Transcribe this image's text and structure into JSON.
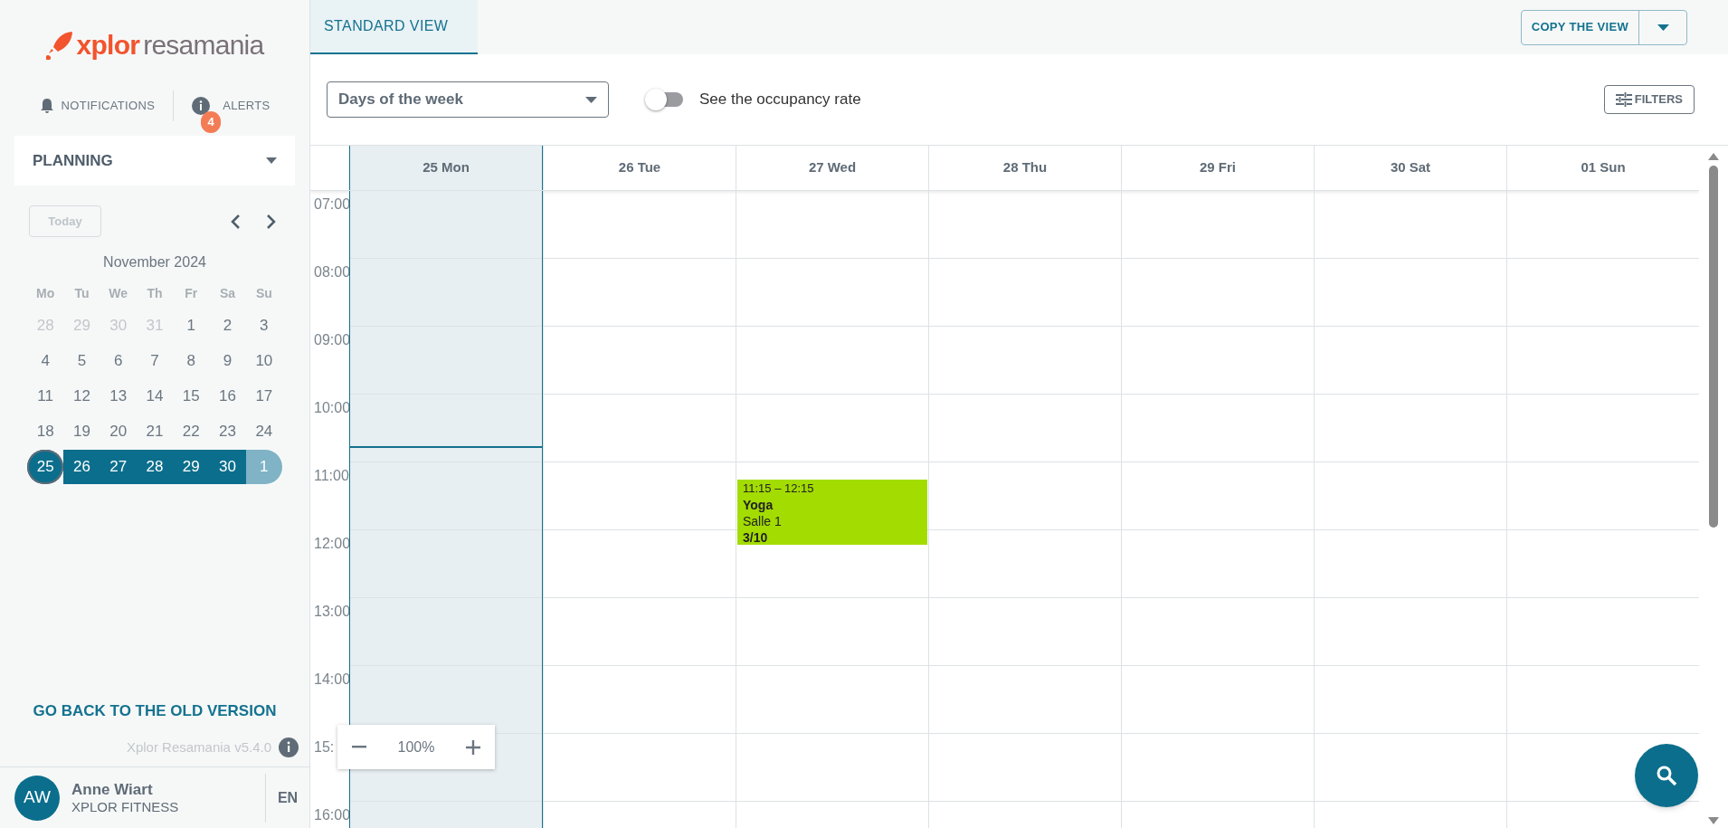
{
  "sidebar": {
    "logo": {
      "brand": "xplor",
      "product": "resamania"
    },
    "notifications": "NOTIFICATIONS",
    "alerts": {
      "label": "ALERTS",
      "count": "4"
    },
    "menu": "PLANNING",
    "today_button": "Today",
    "calendar": {
      "month": "November 2024",
      "weekdays": [
        "Mo",
        "Tu",
        "We",
        "Th",
        "Fr",
        "Sa",
        "Su"
      ],
      "weeks": [
        [
          {
            "day": "28",
            "muted": true,
            "selected": false,
            "today": false
          },
          {
            "day": "29",
            "muted": true,
            "selected": false,
            "today": false
          },
          {
            "day": "30",
            "muted": true,
            "selected": false,
            "today": false
          },
          {
            "day": "31",
            "muted": true,
            "selected": false,
            "today": false
          },
          {
            "day": "1",
            "muted": false,
            "selected": false,
            "today": false
          },
          {
            "day": "2",
            "muted": false,
            "selected": false,
            "today": false
          },
          {
            "day": "3",
            "muted": false,
            "selected": false,
            "today": false
          }
        ],
        [
          {
            "day": "4",
            "muted": false,
            "selected": false,
            "today": false
          },
          {
            "day": "5",
            "muted": false,
            "selected": false,
            "today": false
          },
          {
            "day": "6",
            "muted": false,
            "selected": false,
            "today": false
          },
          {
            "day": "7",
            "muted": false,
            "selected": false,
            "today": false
          },
          {
            "day": "8",
            "muted": false,
            "selected": false,
            "today": false
          },
          {
            "day": "9",
            "muted": false,
            "selected": false,
            "today": false
          },
          {
            "day": "10",
            "muted": false,
            "selected": false,
            "today": false
          }
        ],
        [
          {
            "day": "11",
            "muted": false,
            "selected": false,
            "today": false
          },
          {
            "day": "12",
            "muted": false,
            "selected": false,
            "today": false
          },
          {
            "day": "13",
            "muted": false,
            "selected": false,
            "today": false
          },
          {
            "day": "14",
            "muted": false,
            "selected": false,
            "today": false
          },
          {
            "day": "15",
            "muted": false,
            "selected": false,
            "today": false
          },
          {
            "day": "16",
            "muted": false,
            "selected": false,
            "today": false
          },
          {
            "day": "17",
            "muted": false,
            "selected": false,
            "today": false
          }
        ],
        [
          {
            "day": "18",
            "muted": false,
            "selected": false,
            "today": false
          },
          {
            "day": "19",
            "muted": false,
            "selected": false,
            "today": false
          },
          {
            "day": "20",
            "muted": false,
            "selected": false,
            "today": false
          },
          {
            "day": "21",
            "muted": false,
            "selected": false,
            "today": false
          },
          {
            "day": "22",
            "muted": false,
            "selected": false,
            "today": false
          },
          {
            "day": "23",
            "muted": false,
            "selected": false,
            "today": false
          },
          {
            "day": "24",
            "muted": false,
            "selected": false,
            "today": false
          }
        ],
        [
          {
            "day": "25",
            "muted": false,
            "selected": true,
            "today": true
          },
          {
            "day": "26",
            "muted": false,
            "selected": true,
            "today": false
          },
          {
            "day": "27",
            "muted": false,
            "selected": true,
            "today": false
          },
          {
            "day": "28",
            "muted": false,
            "selected": true,
            "today": false
          },
          {
            "day": "29",
            "muted": false,
            "selected": true,
            "today": false
          },
          {
            "day": "30",
            "muted": false,
            "selected": true,
            "today": false
          },
          {
            "day": "1",
            "muted": true,
            "selected": true,
            "today": false
          }
        ]
      ]
    },
    "back_link": "GO BACK TO THE OLD VERSION",
    "version": "Xplor Resamania v5.4.0",
    "user": {
      "initials": "AW",
      "name": "Anne Wiart",
      "company": "XPLOR FITNESS"
    },
    "language": "EN"
  },
  "tabs": [
    {
      "label": "STANDARD VIEW",
      "selected": true
    }
  ],
  "copy_button": "COPY THE VIEW",
  "view_select": {
    "value": "Days of the week"
  },
  "occupancy_toggle": {
    "label": "See the occupancy rate",
    "on": false
  },
  "filters_button": "FILTERS",
  "days": [
    {
      "label": "25 Mon",
      "today": true
    },
    {
      "label": "26 Tue",
      "today": false
    },
    {
      "label": "27 Wed",
      "today": false,
      "events": [
        {
          "time": "11:15 – 12:15",
          "title": "Yoga",
          "room": "Salle 1",
          "occupancy": "3/10"
        }
      ]
    },
    {
      "label": "28 Thu",
      "today": false
    },
    {
      "label": "29 Fri",
      "today": false
    },
    {
      "label": "30 Sat",
      "today": false
    },
    {
      "label": "01 Sun",
      "today": false
    }
  ],
  "hours": [
    "07:00",
    "08:00",
    "09:00",
    "10:00",
    "11:00",
    "12:00",
    "13:00",
    "14:00",
    "15:",
    "16:00"
  ],
  "zoom": {
    "level": "100%"
  }
}
